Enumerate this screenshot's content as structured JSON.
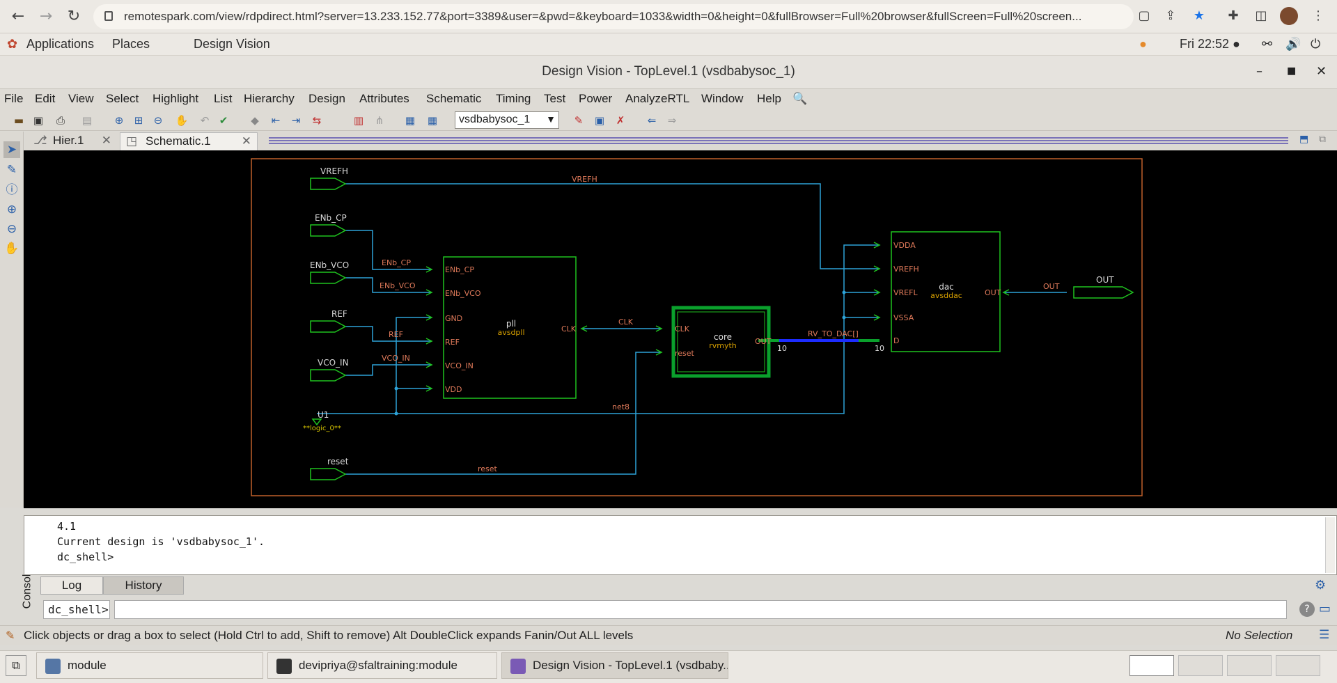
{
  "browser": {
    "url": "remotespark.com/view/rdpdirect.html?server=13.233.152.77&port=3389&user=&pwd=&keyboard=1033&width=0&height=0&fullBrowser=Full%20browser&fullScreen=Full%20screen..."
  },
  "gnome": {
    "applications": "Applications",
    "places": "Places",
    "app": "Design Vision",
    "clock": "Fri 22:52 ●"
  },
  "window": {
    "title": "Design Vision - TopLevel.1 (vsdbabysoc_1)"
  },
  "menu": [
    "File",
    "Edit",
    "View",
    "Select",
    "Highlight",
    "List",
    "Hierarchy",
    "Design",
    "Attributes",
    "Schematic",
    "Timing",
    "Test",
    "Power",
    "AnalyzeRTL",
    "Window",
    "Help"
  ],
  "toolbar": {
    "design_select": "vsdbabysoc_1"
  },
  "tabs": [
    "Hier.1",
    "Schematic.1"
  ],
  "schematic": {
    "ports_in": [
      "VREFH",
      "ENb_CP",
      "ENb_VCO",
      "REF",
      "VCO_IN",
      "reset"
    ],
    "port_out": "OUT",
    "tie": {
      "name": "U1",
      "lib": "**logic_0**"
    },
    "pll": {
      "name": "pll",
      "ref": "avsdpll",
      "pins": [
        "ENb_CP",
        "ENb_VCO",
        "GND",
        "REF",
        "VCO_IN",
        "VDD"
      ],
      "out": "CLK"
    },
    "core": {
      "name": "core",
      "ref": "rvmyth",
      "pins": [
        "CLK",
        "reset"
      ],
      "out": "OUT"
    },
    "dac": {
      "name": "dac",
      "ref": "avsddac",
      "pins": [
        "VDDA",
        "VREFH",
        "VREFL",
        "VSSA",
        "D"
      ],
      "out": "OUT"
    },
    "nets": {
      "vrefh": "VREFH",
      "enb_cp": "ENb_CP",
      "enb_vco": "ENb_VCO",
      "ref": "REF",
      "vco_in": "VCO_IN",
      "clk": "CLK",
      "bus": "RV_TO_DAC[]",
      "net8": "net8",
      "reset": "reset",
      "out": "OUT",
      "bus_width": "10"
    }
  },
  "console": {
    "lines": [
      "4.1",
      "Current design is 'vsdbabysoc_1'.",
      "dc_shell>"
    ],
    "side_label": "Console",
    "tabs": [
      "Log",
      "History"
    ],
    "prompt": "dc_shell>"
  },
  "status": {
    "hint": "Click objects or drag a box to select (Hold Ctrl to add, Shift to remove) Alt DoubleClick expands Fanin/Out ALL levels",
    "selection": "No Selection"
  },
  "taskbar": {
    "items": [
      "module",
      "devipriya@sfaltraining:module",
      "Design Vision - TopLevel.1 (vsdbaby..."
    ]
  }
}
